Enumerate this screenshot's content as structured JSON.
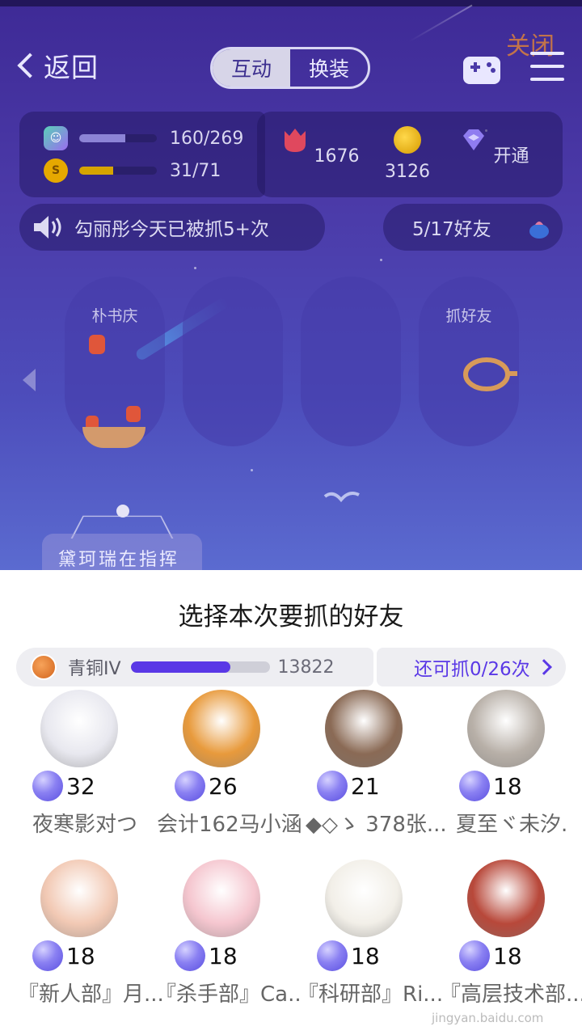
{
  "header": {
    "back_label": "返回",
    "tabs": [
      {
        "label": "互动",
        "active": true
      },
      {
        "label": "换装",
        "active": false
      }
    ],
    "close_label": "关闭",
    "icons": [
      "chevron-left-icon",
      "gamepad-icon",
      "menu-icon"
    ]
  },
  "stats": {
    "exp": {
      "value": "160/269",
      "fraction": 0.595,
      "color": "#8c84d6"
    },
    "coins_level": {
      "value": "31/71",
      "fraction": 0.437,
      "color": "#d6a400"
    },
    "currencies": [
      {
        "icon": "tulip-icon",
        "value": "1676",
        "color": "#e0485e"
      },
      {
        "icon": "gold-coin-icon",
        "value": "3126",
        "color": "#e6b400"
      },
      {
        "icon": "diamond-icon",
        "value": "开通",
        "color": "#8f7cf0"
      }
    ]
  },
  "notice": {
    "text": "勾丽彤今天已被抓5+次",
    "icon": "speaker-icon"
  },
  "friends_caught": {
    "text": "5/17好友",
    "icon": "pot-icon"
  },
  "scene": {
    "pods": [
      {
        "label": "朴书庆"
      },
      {
        "label": ""
      },
      {
        "label": ""
      },
      {
        "label": "抓好友"
      }
    ],
    "sign_text": "黛珂瑞在指挥"
  },
  "sheet": {
    "title": "选择本次要抓的好友",
    "rank": {
      "name": "青铜IV",
      "progress": 0.72,
      "score": "13822"
    },
    "remaining": "还可抓0/26次",
    "friends": [
      {
        "score": "32",
        "name": "夜寒影对つ",
        "avatar_color": "#e8e8ef"
      },
      {
        "score": "26",
        "name": "会计162马小涵",
        "avatar_color": "#e89a3c"
      },
      {
        "score": "21",
        "name": "◆◇ゝ 378张...",
        "avatar_color": "#8a6a55"
      },
      {
        "score": "18",
        "name": "夏至ヾ未汐.",
        "avatar_color": "#b8b0a8"
      },
      {
        "score": "18",
        "name": "『新人部』月...",
        "avatar_color": "#f2c9b4"
      },
      {
        "score": "18",
        "name": "『杀手部』Ca...",
        "avatar_color": "#f5c6cf"
      },
      {
        "score": "18",
        "name": "『科研部』Ri...",
        "avatar_color": "#f2efe8"
      },
      {
        "score": "18",
        "name": "『高层技术部...",
        "avatar_color": "#b8483a"
      }
    ]
  },
  "watermark": "jingyan.baidu.com"
}
